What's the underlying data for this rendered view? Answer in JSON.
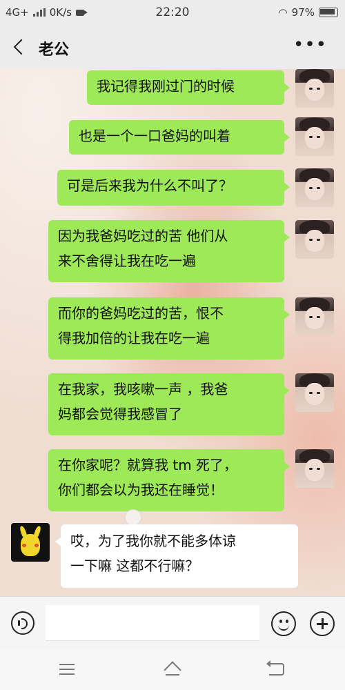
{
  "status": {
    "network": "4G+",
    "speed": "0K/s",
    "time": "22:20",
    "battery": "97%"
  },
  "header": {
    "title": "老公"
  },
  "messages": [
    {
      "side": "me",
      "lines": [
        "我记得我刚过门的时候"
      ]
    },
    {
      "side": "me",
      "lines": [
        "也是一个一口爸妈的叫着"
      ]
    },
    {
      "side": "me",
      "lines": [
        "可是后来我为什么不叫了？"
      ]
    },
    {
      "side": "me",
      "lines": [
        "因为我爸妈吃过的苦  他们从",
        "来不舍得让我在吃一遍"
      ]
    },
    {
      "side": "me",
      "lines": [
        "而你的爸妈吃过的苦，恨不",
        "得我加倍的让我在吃一遍"
      ]
    },
    {
      "side": "me",
      "lines": [
        "在我家，我咳嗽一声  ，我爸",
        "妈都会觉得我感冒了"
      ]
    },
    {
      "side": "me",
      "lines": [
        "在你家呢？就算我 tm 死了，",
        "你们都会以为我还在睡觉！"
      ]
    },
    {
      "side": "them",
      "lines": [
        "哎，为了我你就不能多体谅",
        "一下嘛  这都不行嘛？"
      ]
    }
  ],
  "input": {
    "value": ""
  },
  "icons": {
    "back": "chevron-left-icon",
    "more": "more-icon",
    "voice": "voice-icon",
    "emoji": "emoji-icon",
    "plus": "plus-icon"
  },
  "colors": {
    "my_bubble": "#9de957",
    "their_bubble": "#ffffff"
  }
}
